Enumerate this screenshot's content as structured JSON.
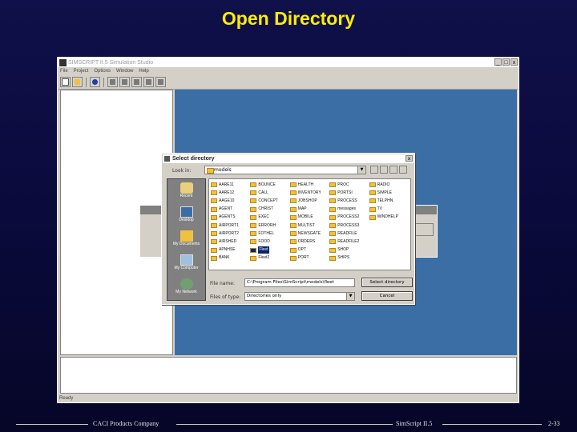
{
  "slide": {
    "title": "Open Directory",
    "footer_left": "CACI Products Company",
    "footer_center": "SimScript II.5",
    "footer_right": "2-33"
  },
  "app": {
    "title": "SIMSCRIPT II.5 Simulation Studio",
    "menu": [
      "File",
      "Project",
      "Options",
      "Window",
      "Help"
    ],
    "status": "Ready",
    "window_buttons": [
      "_",
      "□",
      "x"
    ]
  },
  "dialog": {
    "title": "Select directory",
    "look_in_label": "Look in:",
    "look_in_value": "models",
    "places": [
      "Recent",
      "Desktop",
      "My Documents",
      "My Computer",
      "My Network"
    ],
    "files": [
      "AARE11",
      "AARE12",
      "AAGE10",
      "AGENT",
      "AGENTS",
      "AIRPORT1",
      "AIRPORT2",
      "AIRSHED",
      "APNHSE",
      "BANK",
      "BOUNCE",
      "CALL",
      "CONCEPT",
      "CHRIST",
      "EXEC",
      "ERRORH",
      "FOTHEL",
      "FOOD",
      "Fleet",
      "Fleet2",
      "HEALTH",
      "INVENTORY",
      "JOBSHOP",
      "MAP",
      "MOBILE",
      "MULTIST",
      "NEWSGATE",
      "ORDERS",
      "OPT",
      "PORT",
      "PROC",
      "PORTSI",
      "PROCESS",
      "messages",
      "PROCESS2",
      "PROCESS3",
      "READFILE",
      "READFILE2",
      "SHOP",
      "SHIPS",
      "RADIO",
      "SIMPLE",
      "TELPHN",
      "TV",
      "WINDHELP"
    ],
    "selected_file": "Fleet",
    "file_name_label": "File name:",
    "file_name_value": "C:\\Program Files\\SimScript\\models\\fleet",
    "file_type_label": "Files of type:",
    "file_type_value": "Directories only",
    "ok_button": "Select directory",
    "cancel_button": "Cancel",
    "close_glyph": "x",
    "dropdown_glyph": "▼"
  },
  "colors": {
    "slide_title": "#ffee00",
    "workspace": "#3a6ea5",
    "selection": "#0a246a",
    "folder": "#f0c040"
  }
}
